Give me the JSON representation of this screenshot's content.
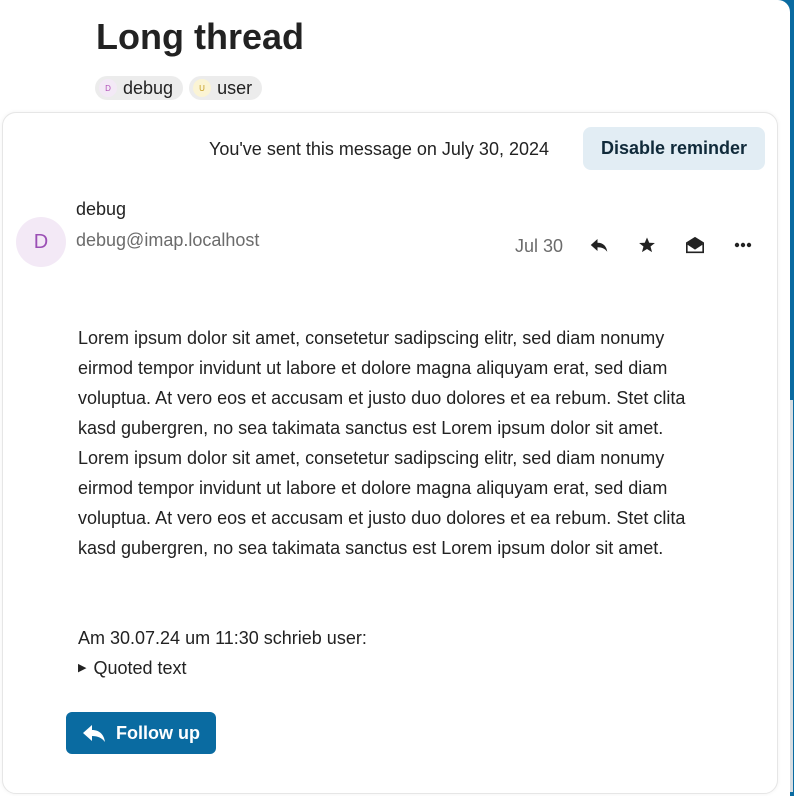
{
  "thread": {
    "title": "Long thread",
    "tags": [
      {
        "label": "debug",
        "initial": "D",
        "color": "#b14fb8"
      },
      {
        "label": "user",
        "initial": "U",
        "color": "#c49a1a"
      }
    ]
  },
  "reminder": {
    "text": "You've sent this message on July 30, 2024",
    "button_label": "Disable reminder"
  },
  "message": {
    "avatar_initial": "D",
    "sender_name": "debug",
    "sender_email": "debug@imap.localhost",
    "date": "Jul 30",
    "actions": [
      "reply-icon",
      "star-icon",
      "mark-read-icon",
      "more-icon"
    ],
    "body": "Lorem ipsum dolor sit amet, consetetur sadipscing elitr, sed diam nonumy eirmod tempor invidunt ut labore et dolore magna aliquyam erat, sed diam voluptua. At vero eos et accusam et justo duo dolores et ea rebum. Stet clita kasd gubergren, no sea takimata sanctus est Lorem ipsum dolor sit amet. Lorem ipsum dolor sit amet, consetetur sadipscing elitr, sed diam nonumy eirmod tempor invidunt ut labore et dolore magna aliquyam erat, sed diam voluptua. At vero eos et accusam et justo duo dolores et ea rebum. Stet clita kasd gubergren, no sea takimata sanctus est Lorem ipsum dolor sit amet.",
    "quote_intro": "Am 30.07.24 um 11:30 schrieb user:",
    "quoted_toggle_label": "Quoted text",
    "follow_up_label": "Follow up"
  },
  "colors": {
    "accent": "#0a6ba1",
    "reminder_button_bg": "#e2edf4"
  }
}
